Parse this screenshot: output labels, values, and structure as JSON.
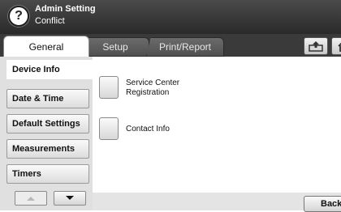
{
  "header": {
    "title": "Admin Setting",
    "subtitle": "Conflict",
    "help_glyph": "?"
  },
  "tabs": [
    {
      "label": "General",
      "selected": true
    },
    {
      "label": "Setup",
      "selected": false
    },
    {
      "label": "Print/Report",
      "selected": false
    }
  ],
  "toolbar_icons": [
    "upload-icon",
    "home-icon"
  ],
  "sidebar": {
    "items": [
      {
        "label": "Device Info",
        "selected": true
      },
      {
        "label": "Date & Time",
        "selected": false
      },
      {
        "label": "Default Settings",
        "selected": false
      },
      {
        "label": "Measurements",
        "selected": false
      },
      {
        "label": "Timers",
        "selected": false
      }
    ],
    "scroll_up_icon": "triangle-up-icon",
    "scroll_down_icon": "triangle-down-icon"
  },
  "main": {
    "items": [
      {
        "label": "Service Center Registration"
      },
      {
        "label": "Contact Info"
      }
    ]
  },
  "footer": {
    "back_label": "Back"
  },
  "colors": {
    "title_bar": "#333333",
    "tab_inactive": "#5e5e5e",
    "sidebar_bg": "#e0e0e0",
    "footer_bg": "#e4e4e4"
  }
}
